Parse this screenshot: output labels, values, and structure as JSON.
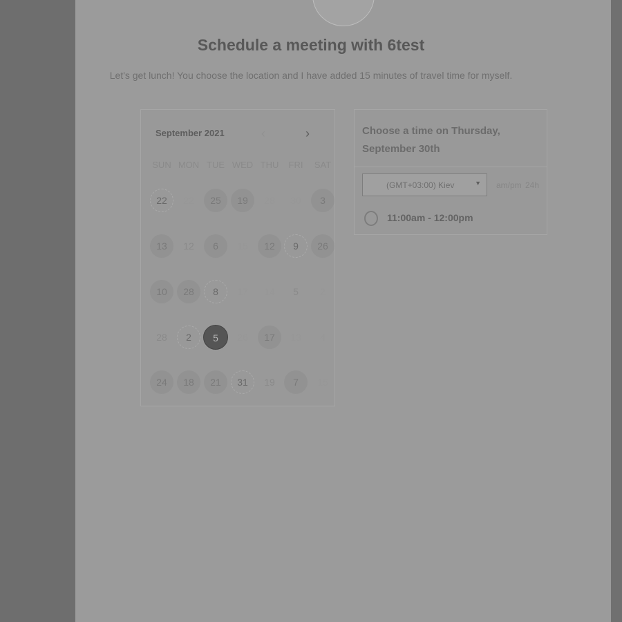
{
  "header": {
    "title": "Schedule a meeting with 6test",
    "subtitle": "Let's get lunch! You choose the location and I have added 15 minutes of travel time for myself."
  },
  "calendar": {
    "month_label": "September 2021",
    "prev_icon": "chevron-left-icon",
    "next_icon": "chevron-right-icon",
    "weekdays": [
      "SUN",
      "MON",
      "TUE",
      "WED",
      "THU",
      "FRI",
      "SAT"
    ],
    "weeks": [
      [
        {
          "d": "22",
          "s": "dotted"
        },
        {
          "d": "22",
          "s": "faint"
        },
        {
          "d": "25",
          "s": "avail"
        },
        {
          "d": "19",
          "s": "avail"
        },
        {
          "d": "28",
          "s": "faint"
        },
        {
          "d": "30",
          "s": "faint"
        },
        {
          "d": "3",
          "s": "avail"
        }
      ],
      [
        {
          "d": "13",
          "s": "avail"
        },
        {
          "d": "12",
          "s": "plain"
        },
        {
          "d": "6",
          "s": "avail"
        },
        {
          "d": "15",
          "s": "faint"
        },
        {
          "d": "12",
          "s": "avail"
        },
        {
          "d": "9",
          "s": "dotted"
        },
        {
          "d": "26",
          "s": "avail"
        }
      ],
      [
        {
          "d": "10",
          "s": "avail"
        },
        {
          "d": "28",
          "s": "avail"
        },
        {
          "d": "8",
          "s": "dotted"
        },
        {
          "d": "17",
          "s": "faint"
        },
        {
          "d": "14",
          "s": "faint"
        },
        {
          "d": "5",
          "s": "plain"
        },
        {
          "d": "2",
          "s": "faint"
        }
      ],
      [
        {
          "d": "28",
          "s": "plain"
        },
        {
          "d": "2",
          "s": "dotted"
        },
        {
          "d": "5",
          "s": "selected"
        },
        {
          "d": "26",
          "s": "faint"
        },
        {
          "d": "17",
          "s": "avail"
        },
        {
          "d": "13",
          "s": "faint"
        },
        {
          "d": "4",
          "s": "faint"
        }
      ],
      [
        {
          "d": "24",
          "s": "avail"
        },
        {
          "d": "18",
          "s": "avail"
        },
        {
          "d": "21",
          "s": "avail"
        },
        {
          "d": "31",
          "s": "dotted"
        },
        {
          "d": "19",
          "s": "plain"
        },
        {
          "d": "7",
          "s": "avail"
        },
        {
          "d": "15",
          "s": "faint"
        }
      ]
    ]
  },
  "times": {
    "heading": "Choose a time on Thursday, September 30th",
    "timezone": "(GMT+03:00) Kiev",
    "format_ampm": "am/pm",
    "format_24h": "24h",
    "slots": [
      "11:00am - 12:00pm"
    ]
  }
}
